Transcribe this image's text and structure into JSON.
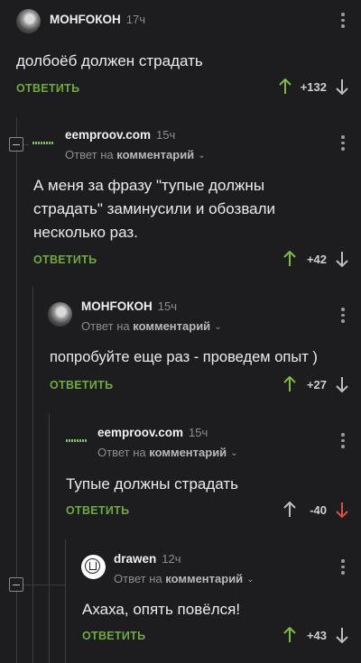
{
  "comments": [
    {
      "author": "МОНFОКОН",
      "time": "17ч",
      "reply_prefix": "",
      "reply_target": "",
      "text": "долбоёб должен страдать",
      "reply_label": "ОТВЕТИТЬ",
      "score": "+132",
      "avatar": "photo-avatar"
    },
    {
      "author": "eemproov.com",
      "time": "15ч",
      "reply_prefix": "Ответ на",
      "reply_target": "комментарий",
      "text": "А меня за фразу \"тупые должны страдать\" заминусили и обозвали несколько раз.",
      "reply_label": "ОТВЕТИТЬ",
      "score": "+42",
      "avatar": "logo-avatar"
    },
    {
      "author": "МОНFОКОН",
      "time": "15ч",
      "reply_prefix": "Ответ на",
      "reply_target": "комментарий",
      "text": "попробуйте еще раз - проведем опыт )",
      "reply_label": "ОТВЕТИТЬ",
      "score": "+27",
      "avatar": "photo-avatar"
    },
    {
      "author": "eemproov.com",
      "time": "15ч",
      "reply_prefix": "Ответ на",
      "reply_target": "комментарий",
      "text": "Тупые должны страдать",
      "reply_label": "ОТВЕТИТЬ",
      "score": "-40",
      "avatar": "logo-avatar"
    },
    {
      "author": "drawen",
      "time": "12ч",
      "reply_prefix": "Ответ на",
      "reply_target": "комментарий",
      "text": "Ахаха, опять повёлся!",
      "reply_label": "ОТВЕТИТЬ",
      "score": "+43",
      "avatar": "ring-avatar"
    }
  ],
  "colors": {
    "background": "#1d1d1f",
    "accent_green": "#6faa3d",
    "upvote_green": "#7dbb45",
    "downvote_red": "#d2533f",
    "muted": "#8d8d8d"
  }
}
